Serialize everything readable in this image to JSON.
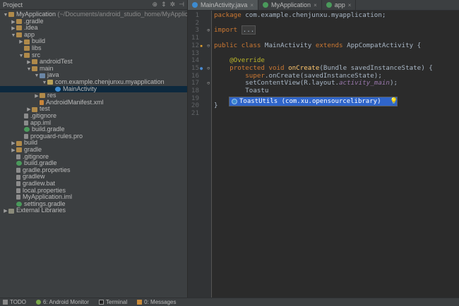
{
  "project_panel": {
    "title": "Project",
    "header_icons": [
      "target-icon",
      "split-icon",
      "gear-icon",
      "hide-icon"
    ],
    "tree": [
      {
        "label": "MyApplication",
        "suffix": " (~/Documents/android_studio_home/MyApplication)",
        "indent": 0,
        "arrow": "▼",
        "icon": "folder"
      },
      {
        "label": ".gradle",
        "indent": 1,
        "arrow": "▶",
        "icon": "folder"
      },
      {
        "label": ".idea",
        "indent": 1,
        "arrow": "▶",
        "icon": "folder"
      },
      {
        "label": "app",
        "indent": 1,
        "arrow": "▼",
        "icon": "folder"
      },
      {
        "label": "build",
        "indent": 2,
        "arrow": "▶",
        "icon": "folder"
      },
      {
        "label": "libs",
        "indent": 2,
        "arrow": "",
        "icon": "folder"
      },
      {
        "label": "src",
        "indent": 2,
        "arrow": "▼",
        "icon": "folder"
      },
      {
        "label": "androidTest",
        "indent": 3,
        "arrow": "▶",
        "icon": "folder"
      },
      {
        "label": "main",
        "indent": 3,
        "arrow": "▼",
        "icon": "folder"
      },
      {
        "label": "java",
        "indent": 4,
        "arrow": "▼",
        "icon": "folder-src"
      },
      {
        "label": "com.example.chenjunxu.myapplication",
        "indent": 5,
        "arrow": "▼",
        "icon": "pkg"
      },
      {
        "label": "MainActivity",
        "indent": 6,
        "arrow": "",
        "icon": "class",
        "selected": true
      },
      {
        "label": "res",
        "indent": 4,
        "arrow": "▶",
        "icon": "folder"
      },
      {
        "label": "AndroidManifest.xml",
        "indent": 4,
        "arrow": "",
        "icon": "xml"
      },
      {
        "label": "test",
        "indent": 3,
        "arrow": "▶",
        "icon": "folder"
      },
      {
        "label": ".gitignore",
        "indent": 2,
        "arrow": "",
        "icon": "file"
      },
      {
        "label": "app.iml",
        "indent": 2,
        "arrow": "",
        "icon": "file"
      },
      {
        "label": "build.gradle",
        "indent": 2,
        "arrow": "",
        "icon": "gradle"
      },
      {
        "label": "proguard-rules.pro",
        "indent": 2,
        "arrow": "",
        "icon": "file"
      },
      {
        "label": "build",
        "indent": 1,
        "arrow": "▶",
        "icon": "folder"
      },
      {
        "label": "gradle",
        "indent": 1,
        "arrow": "▶",
        "icon": "folder"
      },
      {
        "label": ".gitignore",
        "indent": 1,
        "arrow": "",
        "icon": "file"
      },
      {
        "label": "build.gradle",
        "indent": 1,
        "arrow": "",
        "icon": "gradle"
      },
      {
        "label": "gradle.properties",
        "indent": 1,
        "arrow": "",
        "icon": "file"
      },
      {
        "label": "gradlew",
        "indent": 1,
        "arrow": "",
        "icon": "file"
      },
      {
        "label": "gradlew.bat",
        "indent": 1,
        "arrow": "",
        "icon": "file"
      },
      {
        "label": "local.properties",
        "indent": 1,
        "arrow": "",
        "icon": "file"
      },
      {
        "label": "MyApplication.iml",
        "indent": 1,
        "arrow": "",
        "icon": "file"
      },
      {
        "label": "settings.gradle",
        "indent": 1,
        "arrow": "",
        "icon": "gradle"
      },
      {
        "label": "External Libraries",
        "indent": 0,
        "arrow": "▶",
        "icon": "lib"
      }
    ]
  },
  "tabs": [
    {
      "label": "MainActivity.java",
      "active": true,
      "icon": "class"
    },
    {
      "label": "MyApplication",
      "active": false,
      "icon": "gradle"
    },
    {
      "label": "app",
      "active": false,
      "icon": "gradle"
    }
  ],
  "editor": {
    "line_numbers": [
      "1",
      "2",
      "3",
      "11",
      "12",
      "13",
      "14",
      "15",
      "16",
      "17",
      "18",
      "19",
      "20",
      "21"
    ],
    "lines": [
      [
        {
          "t": "package ",
          "c": "kw"
        },
        {
          "t": "com.example.chenjunxu.myapplication;",
          "c": ""
        }
      ],
      [],
      [
        {
          "t": "import ",
          "c": "kw"
        },
        {
          "t": "...",
          "c": "fold-box"
        }
      ],
      [],
      [
        {
          "t": "public class ",
          "c": "kw"
        },
        {
          "t": "MainActivity ",
          "c": ""
        },
        {
          "t": "extends ",
          "c": "kw"
        },
        {
          "t": "AppCompatActivity {",
          "c": ""
        }
      ],
      [],
      [
        {
          "t": "    @Override",
          "c": "ann"
        }
      ],
      [
        {
          "t": "    protected void ",
          "c": "kw"
        },
        {
          "t": "onCreate",
          "c": "fn"
        },
        {
          "t": "(Bundle savedInstanceState) {",
          "c": ""
        }
      ],
      [
        {
          "t": "        super",
          "c": "kw"
        },
        {
          "t": ".onCreate(savedInstanceState);",
          "c": ""
        }
      ],
      [
        {
          "t": "        setContentView(R.layout.",
          "c": ""
        },
        {
          "t": "activity_main",
          "c": "it"
        },
        {
          "t": ");",
          "c": ""
        }
      ],
      [
        {
          "t": "        Toastu",
          "c": ""
        }
      ],
      [],
      [
        {
          "t": "}",
          "c": ""
        }
      ],
      []
    ]
  },
  "autocomplete": {
    "suggestion": "ToastUtils (com.xu.opensourcelibrary)"
  },
  "bottom_bar": [
    {
      "label": "TODO",
      "icon": "todo"
    },
    {
      "label": "6: Android Monitor",
      "icon": "and"
    },
    {
      "label": "Terminal",
      "icon": "term"
    },
    {
      "label": "0: Messages",
      "icon": "msg"
    }
  ]
}
